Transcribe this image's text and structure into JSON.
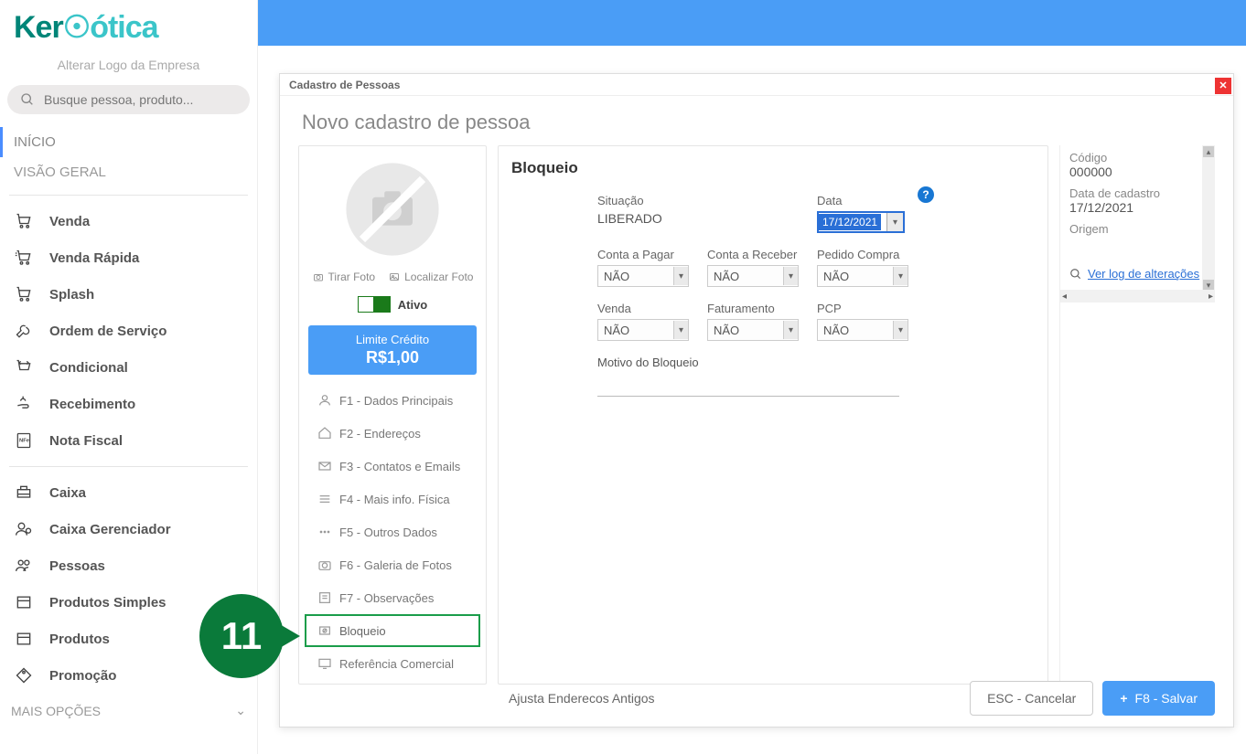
{
  "brand": {
    "part1": "Ker",
    "part2": "o",
    "part3": "ótica"
  },
  "sidebar": {
    "alter_logo": "Alterar Logo da Empresa",
    "search_placeholder": "Busque pessoa, produto...",
    "inicio": "INÍCIO",
    "visao": "VISÃO GERAL",
    "items1": [
      {
        "label": "Venda"
      },
      {
        "label": "Venda Rápida"
      },
      {
        "label": "Splash"
      },
      {
        "label": "Ordem de Serviço"
      },
      {
        "label": "Condicional"
      },
      {
        "label": "Recebimento"
      },
      {
        "label": "Nota Fiscal"
      }
    ],
    "items2": [
      {
        "label": "Caixa"
      },
      {
        "label": "Caixa Gerenciador"
      },
      {
        "label": "Pessoas"
      },
      {
        "label": "Produtos Simples"
      },
      {
        "label": "Produtos"
      },
      {
        "label": "Promoção"
      }
    ],
    "mais": "MAIS OPÇÕES"
  },
  "modal": {
    "titlebar": "Cadastro de Pessoas",
    "header": "Novo cadastro de pessoa",
    "photo": {
      "tirar": "Tirar Foto",
      "localizar": "Localizar Foto"
    },
    "ativo_label": "Ativo",
    "credito": {
      "label": "Limite Crédito",
      "value": "R$1,00"
    },
    "tabs": [
      {
        "label": "F1 - Dados Principais"
      },
      {
        "label": "F2 - Endereços"
      },
      {
        "label": "F3 - Contatos e Emails"
      },
      {
        "label": "F4 - Mais info. Física"
      },
      {
        "label": "F5 - Outros Dados"
      },
      {
        "label": "F6 - Galeria de Fotos"
      },
      {
        "label": "F7 - Observações"
      },
      {
        "label": "Bloqueio"
      },
      {
        "label": "Referência Comercial"
      }
    ],
    "form": {
      "title": "Bloqueio",
      "situacao_label": "Situação",
      "situacao_value": "LIBERADO",
      "data_label": "Data",
      "data_value": "17/12/2021",
      "conta_pagar_label": "Conta a Pagar",
      "conta_receber_label": "Conta a Receber",
      "pedido_compra_label": "Pedido Compra",
      "venda_label": "Venda",
      "faturamento_label": "Faturamento",
      "pcp_label": "PCP",
      "nao": "NÃO",
      "motivo_label": "Motivo do Bloqueio"
    },
    "right": {
      "codigo_label": "Código",
      "codigo_value": "000000",
      "datacad_label": "Data de cadastro",
      "datacad_value": "17/12/2021",
      "origem_label": "Origem",
      "ver_log": "Ver log de alterações"
    },
    "footer": {
      "ajusta": "Ajusta Enderecos Antigos",
      "cancel": "ESC - Cancelar",
      "save": "F8 - Salvar"
    }
  },
  "callout": "11"
}
